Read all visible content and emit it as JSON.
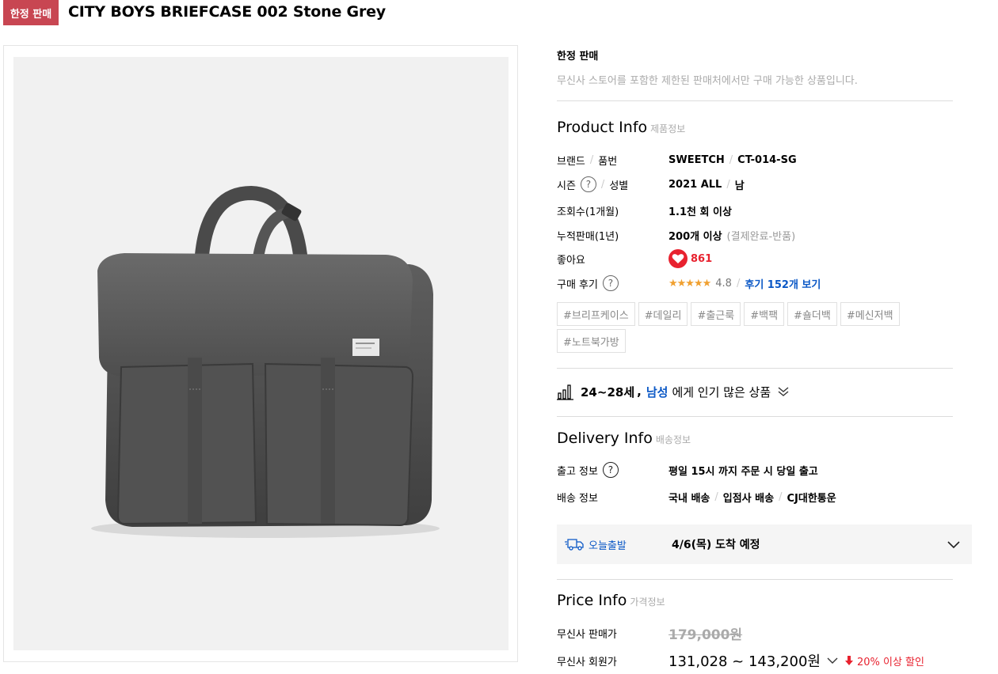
{
  "header": {
    "badge": "한정 판매",
    "title": "CITY BOYS BRIEFCASE 002 Stone Grey"
  },
  "limited": {
    "title": "한정 판매",
    "description": "무신사 스토어를 포함한 제한된 판매처에서만 구매 가능한 상품입니다."
  },
  "product_info": {
    "title": "Product Info",
    "subtitle": "제품정보",
    "brand_label": "브랜드",
    "part_label": "품번",
    "brand": "SWEETCH",
    "part_no": "CT-014-SG",
    "season_label": "시즌",
    "gender_label": "성별",
    "season": "2021 ALL",
    "gender": "남",
    "views_label": "조회수(1개월)",
    "views": "1.1천 회 이상",
    "sales_label": "누적판매(1년)",
    "sales": "200개 이상",
    "sales_note": "(결제완료-반품)",
    "likes_label": "좋아요",
    "likes": "861",
    "review_label": "구매 후기",
    "stars": "★★★★★",
    "rating": "4.8",
    "review_link": "후기 152개 보기"
  },
  "tags": [
    "#브리프케이스",
    "#데일리",
    "#출근룩",
    "#백팩",
    "#숄더백",
    "#메신저백",
    "#노트북가방"
  ],
  "popular": {
    "age": "24~28세",
    "comma": ",",
    "gender": "남성",
    "suffix": "에게 인기 많은 상품"
  },
  "delivery_info": {
    "title": "Delivery Info",
    "subtitle": "배송정보",
    "dispatch_label": "출고 정보",
    "dispatch": "평일 15시 까지 주문 시 당일 출고",
    "shipping_label": "배송 정보",
    "ship_1": "국내 배송",
    "ship_2": "입점사 배송",
    "ship_3": "CJ대한통운",
    "today_label": "오늘출발",
    "eta": "4/6(목) 도착 예정"
  },
  "price_info": {
    "title": "Price Info",
    "subtitle": "가격정보",
    "sale_label": "무신사 판매가",
    "sale_price": "179,000원",
    "member_label": "무신사 회원가",
    "member_price": "131,028 ~ 143,200원",
    "discount": "20% 이상 할인"
  },
  "colors": {
    "badge": "#c84652",
    "link_blue": "#0b58c6",
    "red": "#e8222f"
  }
}
